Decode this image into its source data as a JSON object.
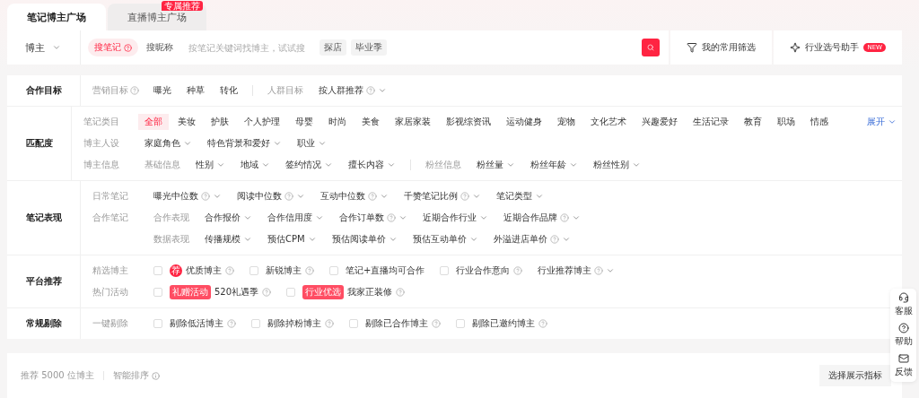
{
  "tabs": [
    {
      "label": "笔记博主广场",
      "selected": true
    },
    {
      "label": "直播博主广场",
      "selected": false,
      "badge": "专属推荐"
    }
  ],
  "search": {
    "scope": "博主",
    "modes": [
      {
        "label": "搜笔记",
        "selected": true,
        "help": true
      },
      {
        "label": "搜昵称",
        "selected": false,
        "help": false
      }
    ],
    "placeholder": "按笔记关键词找博主，试试搜",
    "hints": [
      "探店",
      "毕业季"
    ]
  },
  "quick_actions": [
    {
      "kind": "filter",
      "label": "我的常用筛选"
    },
    {
      "kind": "assistant",
      "label": "行业选号助手",
      "badge": "NEW"
    }
  ],
  "filter_sections": [
    {
      "title": "合作目标",
      "rows": [
        {
          "label": "营销目标",
          "label_help": true,
          "groups": [
            {
              "items": [
                {
                  "kind": "option",
                  "text": "曝光",
                  "selected": false
                },
                {
                  "kind": "option",
                  "text": "种草",
                  "selected": false
                },
                {
                  "kind": "option",
                  "text": "转化",
                  "selected": false
                }
              ]
            },
            {
              "sublabel": "人群目标",
              "items": [
                {
                  "kind": "dropdown",
                  "text": "按人群推荐",
                  "help": true
                }
              ]
            }
          ]
        }
      ]
    },
    {
      "title": "匹配度",
      "rows": [
        {
          "label": "笔记类目",
          "label_help": false,
          "groups": [
            {
              "items": [
                {
                  "kind": "option",
                  "text": "全部",
                  "selected": true
                },
                {
                  "kind": "option",
                  "text": "美妆",
                  "selected": false
                },
                {
                  "kind": "option",
                  "text": "护肤",
                  "selected": false
                },
                {
                  "kind": "option",
                  "text": "个人护理",
                  "selected": false
                },
                {
                  "kind": "option",
                  "text": "母婴",
                  "selected": false
                },
                {
                  "kind": "option",
                  "text": "时尚",
                  "selected": false
                },
                {
                  "kind": "option",
                  "text": "美食",
                  "selected": false
                },
                {
                  "kind": "option",
                  "text": "家居家装",
                  "selected": false
                },
                {
                  "kind": "option",
                  "text": "影视综资讯",
                  "selected": false
                },
                {
                  "kind": "option",
                  "text": "运动健身",
                  "selected": false
                },
                {
                  "kind": "option",
                  "text": "宠物",
                  "selected": false
                },
                {
                  "kind": "option",
                  "text": "文化艺术",
                  "selected": false
                },
                {
                  "kind": "option",
                  "text": "兴趣爱好",
                  "selected": false
                },
                {
                  "kind": "option",
                  "text": "生活记录",
                  "selected": false
                },
                {
                  "kind": "option",
                  "text": "教育",
                  "selected": false
                },
                {
                  "kind": "option",
                  "text": "职场",
                  "selected": false
                },
                {
                  "kind": "option",
                  "text": "情感",
                  "selected": false
                },
                {
                  "kind": "expand",
                  "text": "展开"
                }
              ]
            }
          ]
        },
        {
          "label": "博主人设",
          "label_help": false,
          "groups": [
            {
              "items": [
                {
                  "kind": "dropdown",
                  "text": "家庭角色",
                  "help": false
                },
                {
                  "kind": "dropdown",
                  "text": "特色背景和爱好",
                  "help": false
                },
                {
                  "kind": "dropdown",
                  "text": "职业",
                  "help": false
                }
              ]
            }
          ]
        },
        {
          "label": "博主信息",
          "label_help": false,
          "groups": [
            {
              "sublabel": "基础信息",
              "items": [
                {
                  "kind": "dropdown",
                  "text": "性别",
                  "help": false
                },
                {
                  "kind": "dropdown",
                  "text": "地域",
                  "help": false
                },
                {
                  "kind": "dropdown",
                  "text": "签约情况",
                  "help": false
                },
                {
                  "kind": "dropdown",
                  "text": "擅长内容",
                  "help": false
                }
              ]
            },
            {
              "sublabel": "粉丝信息",
              "items": [
                {
                  "kind": "dropdown",
                  "text": "粉丝量",
                  "help": false
                },
                {
                  "kind": "dropdown",
                  "text": "粉丝年龄",
                  "help": false
                },
                {
                  "kind": "dropdown",
                  "text": "粉丝性别",
                  "help": false
                }
              ]
            }
          ]
        }
      ]
    },
    {
      "title": "笔记表现",
      "rows": [
        {
          "label": "日常笔记",
          "label_help": false,
          "groups": [
            {
              "items": [
                {
                  "kind": "dropdown",
                  "text": "曝光中位数",
                  "help": true
                },
                {
                  "kind": "dropdown",
                  "text": "阅读中位数",
                  "help": true
                },
                {
                  "kind": "dropdown",
                  "text": "互动中位数",
                  "help": true
                },
                {
                  "kind": "dropdown",
                  "text": "千赞笔记比例",
                  "help": true
                },
                {
                  "kind": "dropdown",
                  "text": "笔记类型",
                  "help": false
                }
              ]
            }
          ]
        },
        {
          "label": "合作笔记",
          "label_help": false,
          "groups": [
            {
              "sublabel": "合作表现",
              "items": [
                {
                  "kind": "dropdown",
                  "text": "合作报价",
                  "help": false
                },
                {
                  "kind": "dropdown",
                  "text": "合作信用度",
                  "help": false
                },
                {
                  "kind": "dropdown",
                  "text": "合作订单数",
                  "help": true
                },
                {
                  "kind": "dropdown",
                  "text": "近期合作行业",
                  "help": false
                },
                {
                  "kind": "dropdown",
                  "text": "近期合作品牌",
                  "help": true
                }
              ]
            }
          ]
        },
        {
          "groups": [
            {
              "sublabel": "数据表现",
              "items": [
                {
                  "kind": "dropdown",
                  "text": "传播规模",
                  "help": false
                },
                {
                  "kind": "dropdown",
                  "text": "预估CPM",
                  "help": false
                },
                {
                  "kind": "dropdown",
                  "text": "预估阅读单价",
                  "help": false
                },
                {
                  "kind": "dropdown",
                  "text": "预估互动单价",
                  "help": false
                },
                {
                  "kind": "dropdown",
                  "text": "外溢进店单价",
                  "help": true
                }
              ]
            }
          ]
        }
      ]
    },
    {
      "title": "平台推荐",
      "rows": [
        {
          "label": "精选博主",
          "label_help": false,
          "groups": [
            {
              "items": [
                {
                  "kind": "check",
                  "text": "优质博主",
                  "checked": false,
                  "help": true,
                  "tag": {
                    "kind": "dot",
                    "text": "荐"
                  }
                },
                {
                  "kind": "check",
                  "text": "新锐博主",
                  "checked": false,
                  "help": true
                },
                {
                  "kind": "check",
                  "text": "笔记+直播均可合作",
                  "checked": false,
                  "help": false
                },
                {
                  "kind": "check",
                  "text": "行业合作意向",
                  "checked": false,
                  "help": true
                },
                {
                  "kind": "dropdown",
                  "text": "行业推荐博主",
                  "help": true
                }
              ]
            }
          ]
        },
        {
          "label": "热门活动",
          "label_help": false,
          "groups": [
            {
              "items": [
                {
                  "kind": "check",
                  "text": "520礼遇季",
                  "checked": false,
                  "help": true,
                  "tag": {
                    "kind": "label",
                    "text": "礼赠活动"
                  }
                },
                {
                  "kind": "check",
                  "text": "我家正装修",
                  "checked": false,
                  "help": true,
                  "tag": {
                    "kind": "label",
                    "text": "行业优选"
                  }
                }
              ]
            }
          ]
        }
      ]
    },
    {
      "title": "常规剔除",
      "rows": [
        {
          "label": "一键剔除",
          "label_help": false,
          "groups": [
            {
              "items": [
                {
                  "kind": "check",
                  "text": "剔除低活博主",
                  "checked": false,
                  "help": true
                },
                {
                  "kind": "check",
                  "text": "剔除掉粉博主",
                  "checked": false,
                  "help": true
                },
                {
                  "kind": "check",
                  "text": "剔除已合作博主",
                  "checked": false,
                  "help": true
                },
                {
                  "kind": "check",
                  "text": "剔除已邀约博主",
                  "checked": false,
                  "help": true
                }
              ]
            }
          ]
        }
      ]
    }
  ],
  "results": {
    "count": "推荐 5000 位博主",
    "sort": "智能排序",
    "button": "选择展示指标"
  },
  "side_tools": [
    {
      "kind": "service",
      "label": "客服"
    },
    {
      "kind": "help",
      "label": "帮助"
    },
    {
      "kind": "feedback",
      "label": "反馈"
    }
  ]
}
